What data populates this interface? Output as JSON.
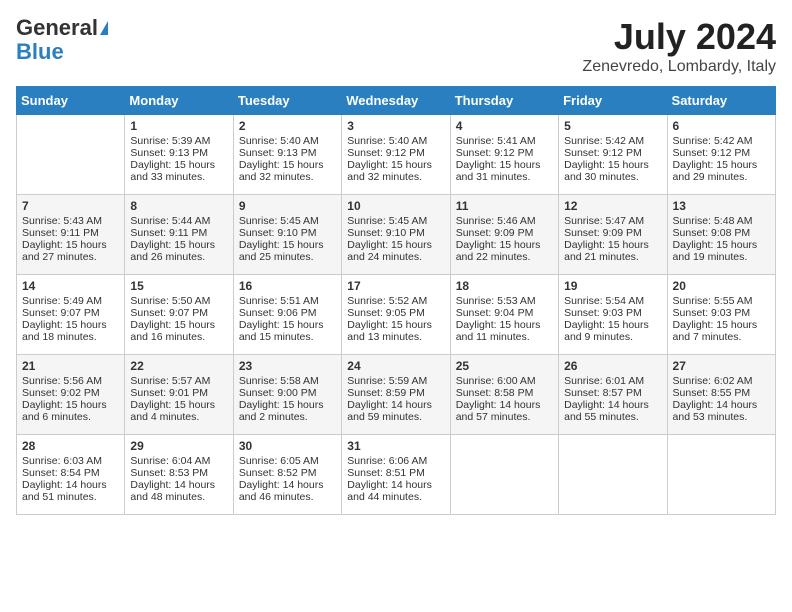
{
  "header": {
    "logo_general": "General",
    "logo_blue": "Blue",
    "title": "July 2024",
    "location": "Zenevredo, Lombardy, Italy"
  },
  "weekdays": [
    "Sunday",
    "Monday",
    "Tuesday",
    "Wednesday",
    "Thursday",
    "Friday",
    "Saturday"
  ],
  "weeks": [
    [
      {
        "day": "",
        "sunrise": "",
        "sunset": "",
        "daylight": ""
      },
      {
        "day": "1",
        "sunrise": "Sunrise: 5:39 AM",
        "sunset": "Sunset: 9:13 PM",
        "daylight": "Daylight: 15 hours and 33 minutes."
      },
      {
        "day": "2",
        "sunrise": "Sunrise: 5:40 AM",
        "sunset": "Sunset: 9:13 PM",
        "daylight": "Daylight: 15 hours and 32 minutes."
      },
      {
        "day": "3",
        "sunrise": "Sunrise: 5:40 AM",
        "sunset": "Sunset: 9:12 PM",
        "daylight": "Daylight: 15 hours and 32 minutes."
      },
      {
        "day": "4",
        "sunrise": "Sunrise: 5:41 AM",
        "sunset": "Sunset: 9:12 PM",
        "daylight": "Daylight: 15 hours and 31 minutes."
      },
      {
        "day": "5",
        "sunrise": "Sunrise: 5:42 AM",
        "sunset": "Sunset: 9:12 PM",
        "daylight": "Daylight: 15 hours and 30 minutes."
      },
      {
        "day": "6",
        "sunrise": "Sunrise: 5:42 AM",
        "sunset": "Sunset: 9:12 PM",
        "daylight": "Daylight: 15 hours and 29 minutes."
      }
    ],
    [
      {
        "day": "7",
        "sunrise": "Sunrise: 5:43 AM",
        "sunset": "Sunset: 9:11 PM",
        "daylight": "Daylight: 15 hours and 27 minutes."
      },
      {
        "day": "8",
        "sunrise": "Sunrise: 5:44 AM",
        "sunset": "Sunset: 9:11 PM",
        "daylight": "Daylight: 15 hours and 26 minutes."
      },
      {
        "day": "9",
        "sunrise": "Sunrise: 5:45 AM",
        "sunset": "Sunset: 9:10 PM",
        "daylight": "Daylight: 15 hours and 25 minutes."
      },
      {
        "day": "10",
        "sunrise": "Sunrise: 5:45 AM",
        "sunset": "Sunset: 9:10 PM",
        "daylight": "Daylight: 15 hours and 24 minutes."
      },
      {
        "day": "11",
        "sunrise": "Sunrise: 5:46 AM",
        "sunset": "Sunset: 9:09 PM",
        "daylight": "Daylight: 15 hours and 22 minutes."
      },
      {
        "day": "12",
        "sunrise": "Sunrise: 5:47 AM",
        "sunset": "Sunset: 9:09 PM",
        "daylight": "Daylight: 15 hours and 21 minutes."
      },
      {
        "day": "13",
        "sunrise": "Sunrise: 5:48 AM",
        "sunset": "Sunset: 9:08 PM",
        "daylight": "Daylight: 15 hours and 19 minutes."
      }
    ],
    [
      {
        "day": "14",
        "sunrise": "Sunrise: 5:49 AM",
        "sunset": "Sunset: 9:07 PM",
        "daylight": "Daylight: 15 hours and 18 minutes."
      },
      {
        "day": "15",
        "sunrise": "Sunrise: 5:50 AM",
        "sunset": "Sunset: 9:07 PM",
        "daylight": "Daylight: 15 hours and 16 minutes."
      },
      {
        "day": "16",
        "sunrise": "Sunrise: 5:51 AM",
        "sunset": "Sunset: 9:06 PM",
        "daylight": "Daylight: 15 hours and 15 minutes."
      },
      {
        "day": "17",
        "sunrise": "Sunrise: 5:52 AM",
        "sunset": "Sunset: 9:05 PM",
        "daylight": "Daylight: 15 hours and 13 minutes."
      },
      {
        "day": "18",
        "sunrise": "Sunrise: 5:53 AM",
        "sunset": "Sunset: 9:04 PM",
        "daylight": "Daylight: 15 hours and 11 minutes."
      },
      {
        "day": "19",
        "sunrise": "Sunrise: 5:54 AM",
        "sunset": "Sunset: 9:03 PM",
        "daylight": "Daylight: 15 hours and 9 minutes."
      },
      {
        "day": "20",
        "sunrise": "Sunrise: 5:55 AM",
        "sunset": "Sunset: 9:03 PM",
        "daylight": "Daylight: 15 hours and 7 minutes."
      }
    ],
    [
      {
        "day": "21",
        "sunrise": "Sunrise: 5:56 AM",
        "sunset": "Sunset: 9:02 PM",
        "daylight": "Daylight: 15 hours and 6 minutes."
      },
      {
        "day": "22",
        "sunrise": "Sunrise: 5:57 AM",
        "sunset": "Sunset: 9:01 PM",
        "daylight": "Daylight: 15 hours and 4 minutes."
      },
      {
        "day": "23",
        "sunrise": "Sunrise: 5:58 AM",
        "sunset": "Sunset: 9:00 PM",
        "daylight": "Daylight: 15 hours and 2 minutes."
      },
      {
        "day": "24",
        "sunrise": "Sunrise: 5:59 AM",
        "sunset": "Sunset: 8:59 PM",
        "daylight": "Daylight: 14 hours and 59 minutes."
      },
      {
        "day": "25",
        "sunrise": "Sunrise: 6:00 AM",
        "sunset": "Sunset: 8:58 PM",
        "daylight": "Daylight: 14 hours and 57 minutes."
      },
      {
        "day": "26",
        "sunrise": "Sunrise: 6:01 AM",
        "sunset": "Sunset: 8:57 PM",
        "daylight": "Daylight: 14 hours and 55 minutes."
      },
      {
        "day": "27",
        "sunrise": "Sunrise: 6:02 AM",
        "sunset": "Sunset: 8:55 PM",
        "daylight": "Daylight: 14 hours and 53 minutes."
      }
    ],
    [
      {
        "day": "28",
        "sunrise": "Sunrise: 6:03 AM",
        "sunset": "Sunset: 8:54 PM",
        "daylight": "Daylight: 14 hours and 51 minutes."
      },
      {
        "day": "29",
        "sunrise": "Sunrise: 6:04 AM",
        "sunset": "Sunset: 8:53 PM",
        "daylight": "Daylight: 14 hours and 48 minutes."
      },
      {
        "day": "30",
        "sunrise": "Sunrise: 6:05 AM",
        "sunset": "Sunset: 8:52 PM",
        "daylight": "Daylight: 14 hours and 46 minutes."
      },
      {
        "day": "31",
        "sunrise": "Sunrise: 6:06 AM",
        "sunset": "Sunset: 8:51 PM",
        "daylight": "Daylight: 14 hours and 44 minutes."
      },
      {
        "day": "",
        "sunrise": "",
        "sunset": "",
        "daylight": ""
      },
      {
        "day": "",
        "sunrise": "",
        "sunset": "",
        "daylight": ""
      },
      {
        "day": "",
        "sunrise": "",
        "sunset": "",
        "daylight": ""
      }
    ]
  ]
}
